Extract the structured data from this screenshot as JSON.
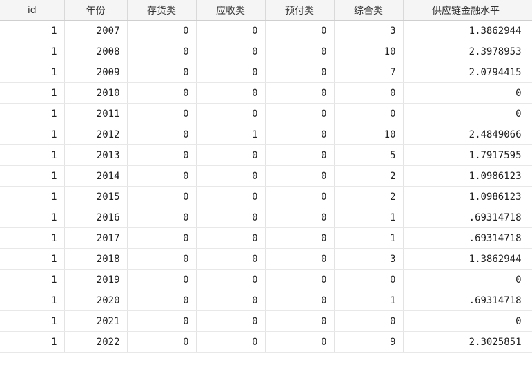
{
  "columns": [
    "id",
    "年份",
    "存货类",
    "应收类",
    "预付类",
    "综合类",
    "供应链金融水平"
  ],
  "rows": [
    [
      "1",
      "2007",
      "0",
      "0",
      "0",
      "3",
      "1.3862944"
    ],
    [
      "1",
      "2008",
      "0",
      "0",
      "0",
      "10",
      "2.3978953"
    ],
    [
      "1",
      "2009",
      "0",
      "0",
      "0",
      "7",
      "2.0794415"
    ],
    [
      "1",
      "2010",
      "0",
      "0",
      "0",
      "0",
      "0"
    ],
    [
      "1",
      "2011",
      "0",
      "0",
      "0",
      "0",
      "0"
    ],
    [
      "1",
      "2012",
      "0",
      "1",
      "0",
      "10",
      "2.4849066"
    ],
    [
      "1",
      "2013",
      "0",
      "0",
      "0",
      "5",
      "1.7917595"
    ],
    [
      "1",
      "2014",
      "0",
      "0",
      "0",
      "2",
      "1.0986123"
    ],
    [
      "1",
      "2015",
      "0",
      "0",
      "0",
      "2",
      "1.0986123"
    ],
    [
      "1",
      "2016",
      "0",
      "0",
      "0",
      "1",
      ".69314718"
    ],
    [
      "1",
      "2017",
      "0",
      "0",
      "0",
      "1",
      ".69314718"
    ],
    [
      "1",
      "2018",
      "0",
      "0",
      "0",
      "3",
      "1.3862944"
    ],
    [
      "1",
      "2019",
      "0",
      "0",
      "0",
      "0",
      "0"
    ],
    [
      "1",
      "2020",
      "0",
      "0",
      "0",
      "1",
      ".69314718"
    ],
    [
      "1",
      "2021",
      "0",
      "0",
      "0",
      "0",
      "0"
    ],
    [
      "1",
      "2022",
      "0",
      "0",
      "0",
      "9",
      "2.3025851"
    ]
  ]
}
